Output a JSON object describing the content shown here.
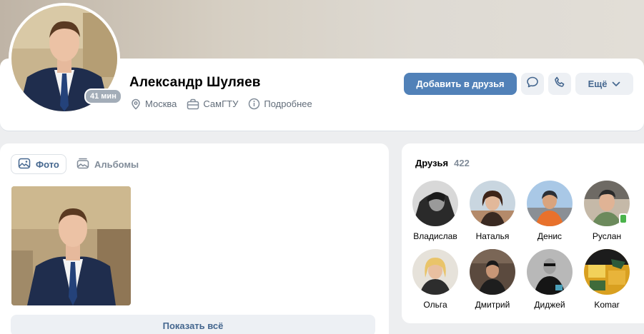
{
  "profile": {
    "name": "Александр Шуляев",
    "online": "41 мин",
    "city": "Москва",
    "university": "СамГТУ",
    "more_info": "Подробнее"
  },
  "actions": {
    "add_friend": "Добавить в друзья",
    "message_icon": "message-icon",
    "call_icon": "phone-icon",
    "more": "Ещё"
  },
  "photos": {
    "tab_photos": "Фото",
    "tab_albums": "Альбомы",
    "show_all": "Показать всё"
  },
  "friends": {
    "title": "Друзья",
    "count": "422",
    "items": [
      {
        "name": "Владислав"
      },
      {
        "name": "Наталья"
      },
      {
        "name": "Денис"
      },
      {
        "name": "Руслан"
      },
      {
        "name": "Ольга"
      },
      {
        "name": "Дмитрий"
      },
      {
        "name": "Диджей"
      },
      {
        "name": "Komar"
      }
    ]
  },
  "colors": {
    "accent": "#5181b8",
    "link": "#45678f",
    "muted": "#818c99",
    "background": "#edeef0"
  }
}
